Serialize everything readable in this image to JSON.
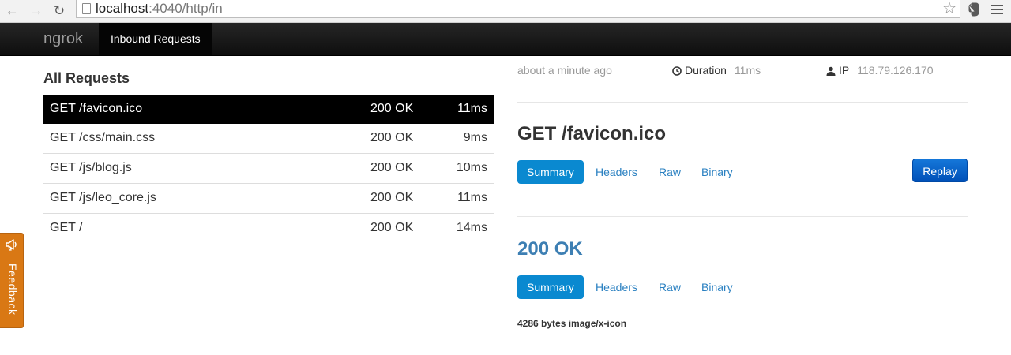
{
  "browser": {
    "url_host": "localhost",
    "url_rest": ":4040/http/in"
  },
  "navbar": {
    "brand": "ngrok",
    "active_tab": "Inbound Requests"
  },
  "requests": {
    "title": "All Requests",
    "rows": [
      {
        "path": "GET /favicon.ico",
        "status": "200 OK",
        "duration": "11ms"
      },
      {
        "path": "GET /css/main.css",
        "status": "200 OK",
        "duration": "9ms"
      },
      {
        "path": "GET /js/blog.js",
        "status": "200 OK",
        "duration": "10ms"
      },
      {
        "path": "GET /js/leo_core.js",
        "status": "200 OK",
        "duration": "11ms"
      },
      {
        "path": "GET /",
        "status": "200 OK",
        "duration": "14ms"
      }
    ]
  },
  "detail": {
    "time_ago": "about a minute ago",
    "duration_label": "Duration",
    "duration_value": "11ms",
    "ip_label": "IP",
    "ip_value": "118.79.126.170",
    "request_title": "GET /favicon.ico",
    "request_tabs": [
      "Summary",
      "Headers",
      "Raw",
      "Binary"
    ],
    "replay_label": "Replay",
    "response_title": "200 OK",
    "response_tabs": [
      "Summary",
      "Headers",
      "Raw",
      "Binary"
    ],
    "response_summary": "4286 bytes image/x-icon"
  },
  "feedback": {
    "label": "Feedback"
  },
  "icons": {
    "back": "arrow-left-icon",
    "forward": "arrow-right-icon",
    "reload": "reload-icon",
    "page": "page-icon",
    "bookmark": "star-icon",
    "extension": "evernote-icon",
    "menu": "hamburger-menu-icon",
    "clock": "clock-icon",
    "user": "user-icon",
    "megaphone": "megaphone-icon"
  },
  "colors": {
    "navbar_bg": "#111111",
    "selected_row_bg": "#000000",
    "tab_active_bg": "#0a89d0",
    "link": "#2a80c1",
    "response_title": "#3d7fb3",
    "replay_bg": "#0a5fc8",
    "feedback_bg": "#d97814"
  }
}
